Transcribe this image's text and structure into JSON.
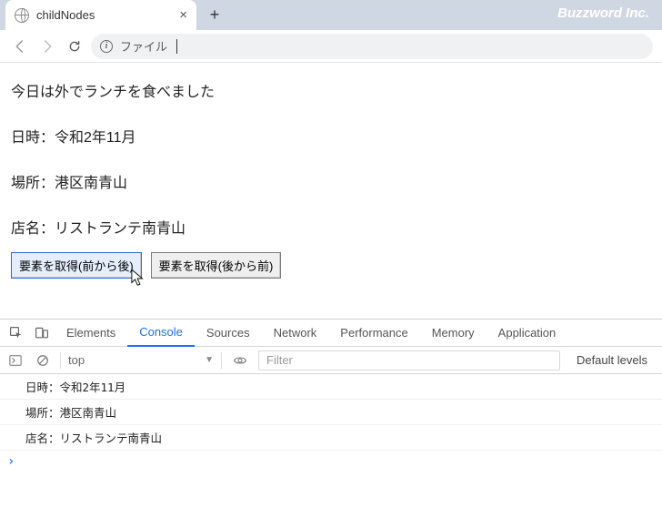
{
  "window": {
    "tab_title": "childNodes",
    "brand": "Buzzword Inc."
  },
  "toolbar": {
    "address_label": "ファイル"
  },
  "page": {
    "heading": "今日は外でランチを食べました",
    "lines": [
      "日時：令和2年11月",
      "場所：港区南青山",
      "店名：リストランテ南青山"
    ],
    "buttons": {
      "forward": "要素を取得(前から後)",
      "backward": "要素を取得(後から前)"
    }
  },
  "devtools": {
    "tabs": [
      "Elements",
      "Console",
      "Sources",
      "Network",
      "Performance",
      "Memory",
      "Application"
    ],
    "active_tab": "Console",
    "context": "top",
    "filter_placeholder": "Filter",
    "levels": "Default levels",
    "logs": [
      "日時：令和2年11月",
      "場所：港区南青山",
      "店名：リストランテ南青山"
    ]
  }
}
